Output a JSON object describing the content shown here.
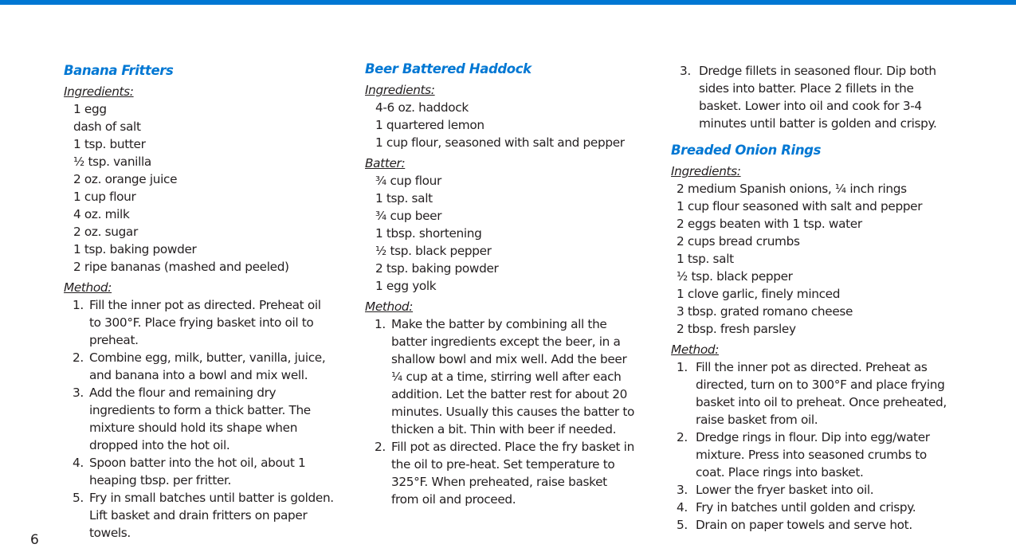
{
  "page": {
    "number": "6",
    "accent_color": "#0077d3"
  },
  "recipes": [
    {
      "title": "Banana Fritters",
      "ingredients_label": "Ingredients:",
      "ingredients": [
        "1 egg",
        "dash of salt",
        "1 tsp. butter",
        "½ tsp. vanilla",
        "2 oz. orange juice",
        "1 cup flour",
        "4 oz. milk",
        "2 oz. sugar",
        "1 tsp. baking powder",
        "2 ripe bananas (mashed and peeled)"
      ],
      "method_label": "Method:",
      "method": [
        {
          "num": "1.",
          "lines": [
            "Fill the inner pot as directed. Preheat oil",
            "to 300°F. Place frying basket into oil to",
            "preheat."
          ]
        },
        {
          "num": "2.",
          "lines": [
            "Combine egg, milk, butter, vanilla, juice,",
            "and banana into a bowl and mix well."
          ]
        },
        {
          "num": "3.",
          "lines": [
            "Add the flour and remaining dry",
            "ingredients to form a thick batter. The",
            "mixture should hold its shape when",
            "dropped into the hot oil."
          ]
        },
        {
          "num": "4.",
          "lines": [
            "Spoon batter into the hot oil, about 1",
            "heaping tbsp. per fritter."
          ]
        },
        {
          "num": "5.",
          "lines": [
            "Fry in small batches until batter is golden.",
            "Lift basket and drain fritters on paper",
            "towels."
          ]
        }
      ]
    },
    {
      "title": "Beer Battered Haddock",
      "ingredients_label": "Ingredients:",
      "ingredients": [
        "4-6 oz. haddock",
        "1 quartered lemon",
        "1 cup flour, seasoned with salt and pepper"
      ],
      "batter_label": "Batter:",
      "batter": [
        "¾ cup flour",
        "1 tsp. salt",
        "¾ cup beer",
        "1 tbsp. shortening",
        "½ tsp. black pepper",
        "2 tsp. baking powder",
        "1 egg yolk"
      ],
      "method_label": "Method:",
      "method": [
        {
          "num": "1.",
          "lines": [
            "Make the batter by combining all the",
            "batter ingredients except the beer, in a",
            "shallow bowl and mix well. Add the beer",
            "¼ cup at a time, stirring well after each",
            "addition. Let the batter rest for about 20",
            "minutes. Usually this causes the batter to",
            "thicken a bit. Thin with beer if needed."
          ]
        },
        {
          "num": "2.",
          "lines": [
            "Fill pot as directed. Place the fry basket in",
            "the oil to pre-heat. Set temperature to",
            "325°F.  When preheated, raise basket",
            "from oil and proceed."
          ]
        },
        {
          "num": "3.",
          "lines": [
            "Dredge fillets in seasoned flour. Dip both",
            "sides into batter. Place 2 fillets in the",
            "basket. Lower into oil and cook for 3-4",
            "minutes until batter is golden and crispy."
          ]
        }
      ]
    },
    {
      "title": "Breaded Onion Rings",
      "ingredients_label": "Ingredients:",
      "ingredients": [
        "2 medium Spanish onions, ¼ inch rings",
        "1 cup flour seasoned with salt and pepper",
        "2 eggs beaten with 1 tsp. water",
        "2 cups bread crumbs",
        "1 tsp. salt",
        "½ tsp. black pepper",
        "1 clove garlic, finely minced",
        "3 tbsp. grated romano cheese",
        "2 tbsp. fresh parsley"
      ],
      "method_label": "Method:",
      "method": [
        {
          "num": "1.",
          "lines": [
            "Fill the inner pot as directed. Preheat as",
            "directed, turn on to 300°F and place frying",
            "basket into oil to preheat. Once preheated,",
            "raise basket from oil."
          ]
        },
        {
          "num": "2.",
          "lines": [
            "Dredge rings in flour. Dip into egg/water",
            "mixture. Press into seasoned crumbs to",
            "coat. Place rings into basket."
          ]
        },
        {
          "num": "3.",
          "lines": [
            "Lower the fryer basket into oil."
          ]
        },
        {
          "num": "4.",
          "lines": [
            "Fry in batches until golden and crispy."
          ]
        },
        {
          "num": "5.",
          "lines": [
            "Drain on paper towels and serve hot."
          ]
        }
      ]
    }
  ]
}
